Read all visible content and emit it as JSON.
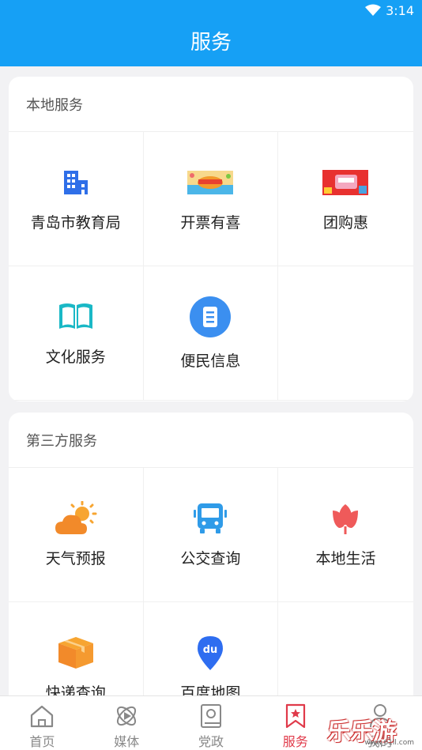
{
  "status": {
    "time": "3:14"
  },
  "header": {
    "title": "服务"
  },
  "sections": {
    "local": {
      "title": "本地服务",
      "items": [
        {
          "label": "青岛市教育局",
          "icon": "building-icon"
        },
        {
          "label": "开票有喜",
          "icon": "invoice-banner-icon"
        },
        {
          "label": "团购惠",
          "icon": "group-buy-banner-icon"
        },
        {
          "label": "文化服务",
          "icon": "book-icon"
        },
        {
          "label": "便民信息",
          "icon": "document-icon"
        }
      ]
    },
    "third": {
      "title": "第三方服务",
      "items": [
        {
          "label": "天气预报",
          "icon": "weather-icon"
        },
        {
          "label": "公交查询",
          "icon": "bus-icon"
        },
        {
          "label": "本地生活",
          "icon": "flower-icon"
        },
        {
          "label": "快递查询",
          "icon": "package-icon"
        },
        {
          "label": "百度地图",
          "icon": "map-pin-icon"
        }
      ]
    }
  },
  "tabs": [
    {
      "label": "首页",
      "icon": "home-icon",
      "active": false
    },
    {
      "label": "媒体",
      "icon": "media-icon",
      "active": false
    },
    {
      "label": "党政",
      "icon": "party-book-icon",
      "active": false
    },
    {
      "label": "服务",
      "icon": "bookmark-star-icon",
      "active": true
    },
    {
      "label": "我的",
      "icon": "user-icon",
      "active": false
    }
  ],
  "watermark": {
    "text": "乐乐游戏",
    "url": "www.61ll.com"
  },
  "colors": {
    "primary": "#16a0f5",
    "active_tab": "#e03a4a"
  }
}
